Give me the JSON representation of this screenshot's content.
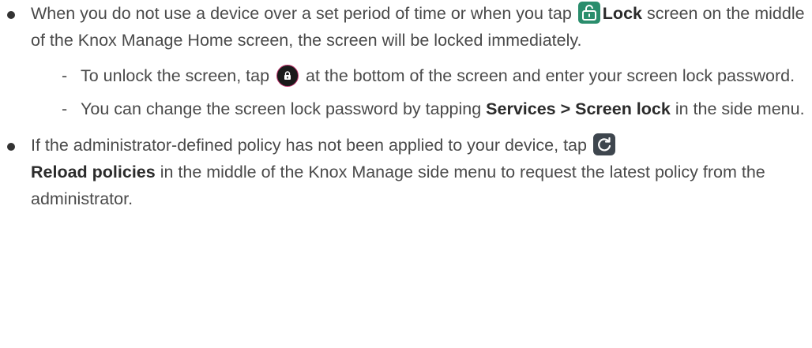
{
  "bullets": [
    {
      "text_before_icon": "When you do not use a device over a set period of time or when you tap ",
      "bold_label": "Lock",
      "text_after_bold": " screen on the middle of the Knox Manage Home screen, the screen will be locked immediately.",
      "icon": "lock-icon",
      "sub_items": [
        {
          "text_before_icon": "To unlock the screen, tap ",
          "icon": "unlock-button-icon",
          "text_after_icon": " at the bottom of the screen and enter your screen lock password."
        },
        {
          "text_before_bold": "You can change the screen lock password by tapping ",
          "bold_label": "Services > Screen lock",
          "text_after_bold": " in the side menu."
        }
      ]
    },
    {
      "text_before_icon": "If the administrator-defined policy has not been applied to your device, tap ",
      "icon": "reload-icon",
      "bold_label": "Reload policies",
      "text_after_bold": " in the middle of the Knox Manage side menu to request the latest policy from the administrator."
    }
  ],
  "colors": {
    "text": "#4a4a4a",
    "bold_text": "#2b2b2b",
    "lock_icon_bg": "#2a8d6c",
    "unlock_icon_bg": "#1a1a1a",
    "unlock_icon_ring": "#c0356f",
    "reload_icon_bg": "#3e464e"
  }
}
